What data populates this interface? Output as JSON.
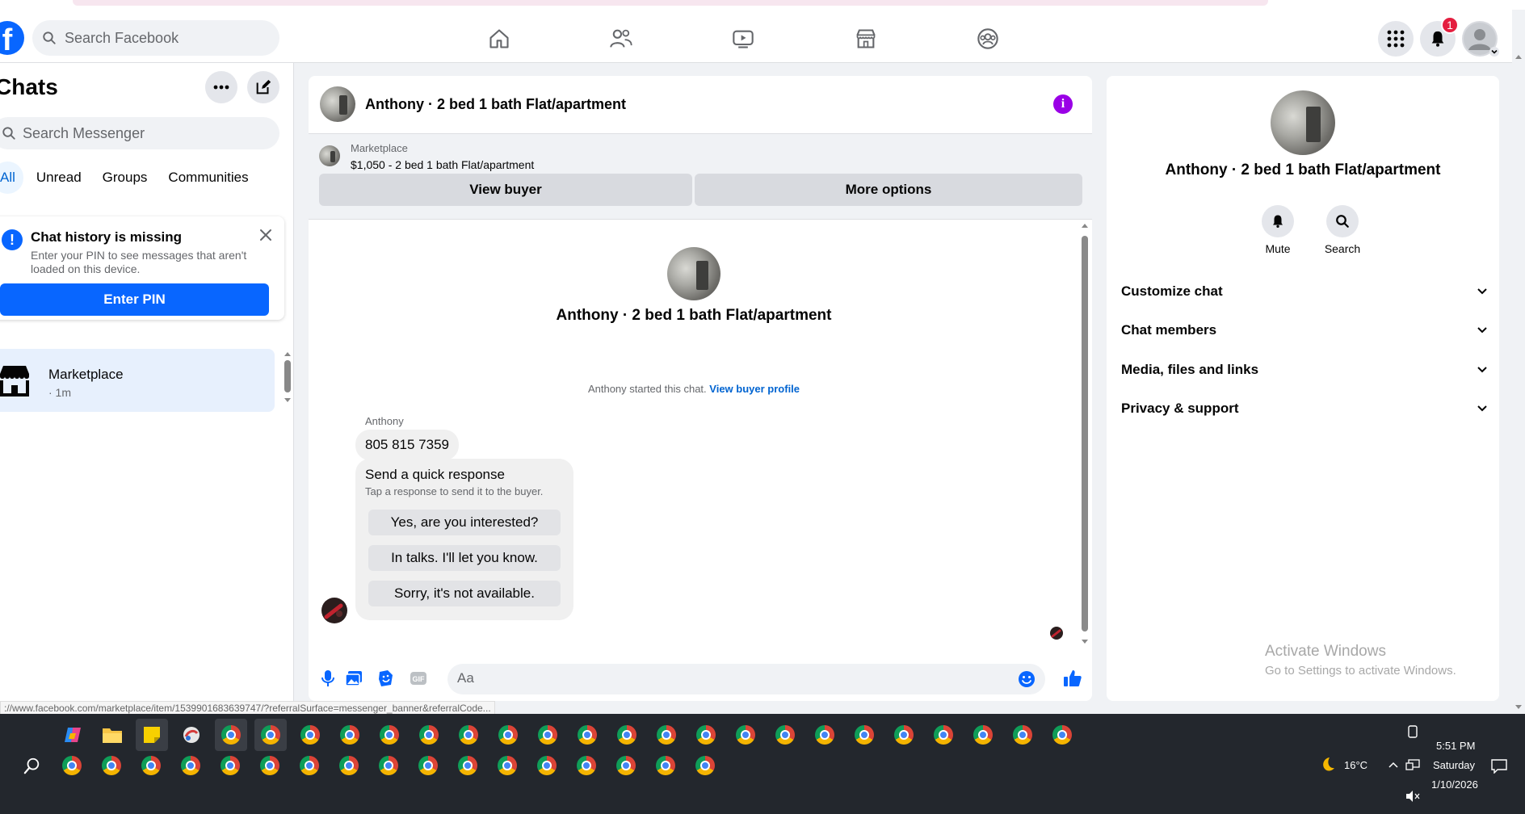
{
  "header": {
    "search_placeholder": "Search Facebook",
    "notification_count": "1",
    "logo_letter": "f"
  },
  "sidebar": {
    "title": "Chats",
    "search_placeholder": "Search Messenger",
    "tabs": [
      {
        "label": "All",
        "active": true
      },
      {
        "label": "Unread"
      },
      {
        "label": "Groups"
      },
      {
        "label": "Communities"
      }
    ],
    "pin_card": {
      "title": "Chat history is missing",
      "description": "Enter your PIN to see messages that aren't loaded on this device.",
      "button": "Enter PIN"
    },
    "conversation": {
      "name": "Marketplace",
      "meta": "· 1m"
    }
  },
  "chat": {
    "title": "Anthony · 2 bed 1 bath Flat/apartment",
    "marketplace": {
      "label": "Marketplace",
      "listing": "$1,050 - 2 bed 1 bath Flat/apartment",
      "view_buyer": "View buyer",
      "more_options": "More options"
    },
    "intro_name": "Anthony · 2 bed 1 bath Flat/apartment",
    "started_text": "Anthony started this chat.",
    "started_link": "View buyer profile",
    "sender": "Anthony",
    "message": "805 815 7359",
    "quick_response": {
      "title": "Send a quick response",
      "subtitle": "Tap a response to send it to the buyer.",
      "options": [
        "Yes, are you interested?",
        "In talks. I'll let you know.",
        "Sorry, it's not available."
      ]
    },
    "composer_placeholder": "Aa"
  },
  "right_panel": {
    "name": "Anthony · 2 bed 1 bath Flat/apartment",
    "actions": [
      {
        "label": "Mute"
      },
      {
        "label": "Search"
      }
    ],
    "sections": [
      "Customize chat",
      "Chat members",
      "Media, files and links",
      "Privacy & support"
    ]
  },
  "watermark": {
    "title": "Activate Windows",
    "subtitle": "Go to Settings to activate Windows."
  },
  "status_url": "://www.facebook.com/marketplace/item/1539901683639747/?referralSurface=messenger_banner&referralCode...",
  "taskbar": {
    "time": "5:51 PM",
    "day": "Saturday",
    "date": "1/10/2026",
    "weather": "16°C"
  },
  "colors": {
    "brand": "#0866ff",
    "info": "#9a00e6",
    "badge": "#e41e3f"
  }
}
